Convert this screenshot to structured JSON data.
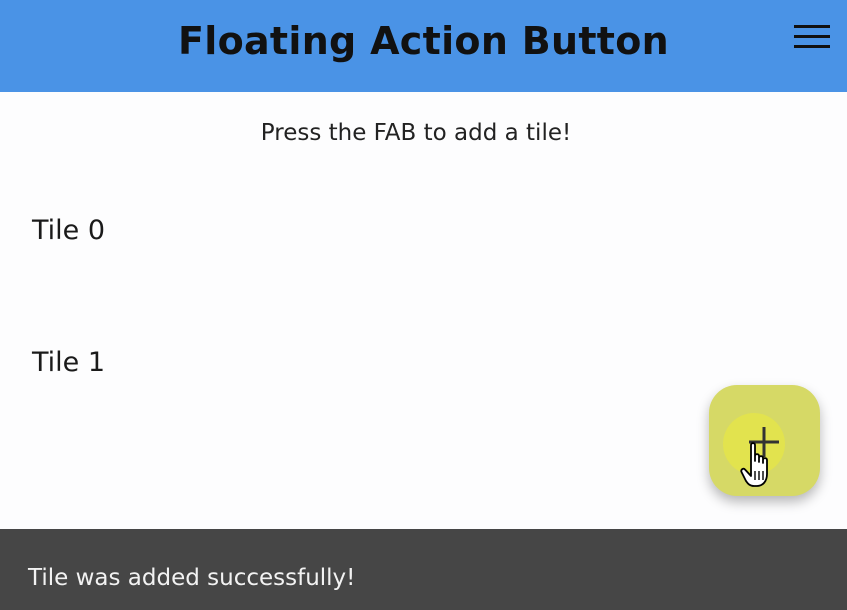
{
  "appbar": {
    "title": "Floating Action Button",
    "menu_icon": "menu-icon",
    "color": "#4a93e6"
  },
  "content": {
    "hint": "Press the FAB to add a tile!",
    "tiles": [
      {
        "label": "Tile 0"
      },
      {
        "label": "Tile 1"
      }
    ]
  },
  "fab": {
    "icon": "plus-icon",
    "color": "#d6d966"
  },
  "snackbar": {
    "message": "Tile was added successfully!",
    "color": "#464646"
  }
}
